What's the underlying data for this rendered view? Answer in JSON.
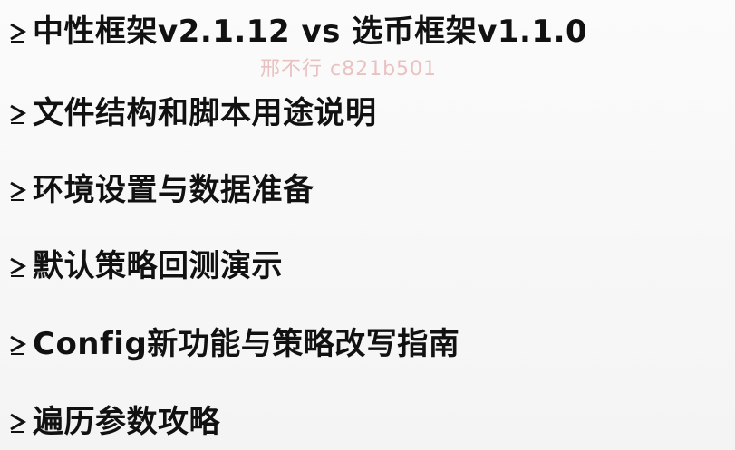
{
  "slide": {
    "watermark": "邢不行 c821b501",
    "bullet_icon": "chevron-right-arrow-icon",
    "items": [
      {
        "text": "中性框架v2.1.12 vs 选币框架v1.1.0"
      },
      {
        "text": "文件结构和脚本用途说明"
      },
      {
        "text": "环境设置与数据准备"
      },
      {
        "text": "默认策略回测演示"
      },
      {
        "text": "Config新功能与策略改写指南"
      },
      {
        "text": "遍历参数攻略"
      }
    ]
  }
}
